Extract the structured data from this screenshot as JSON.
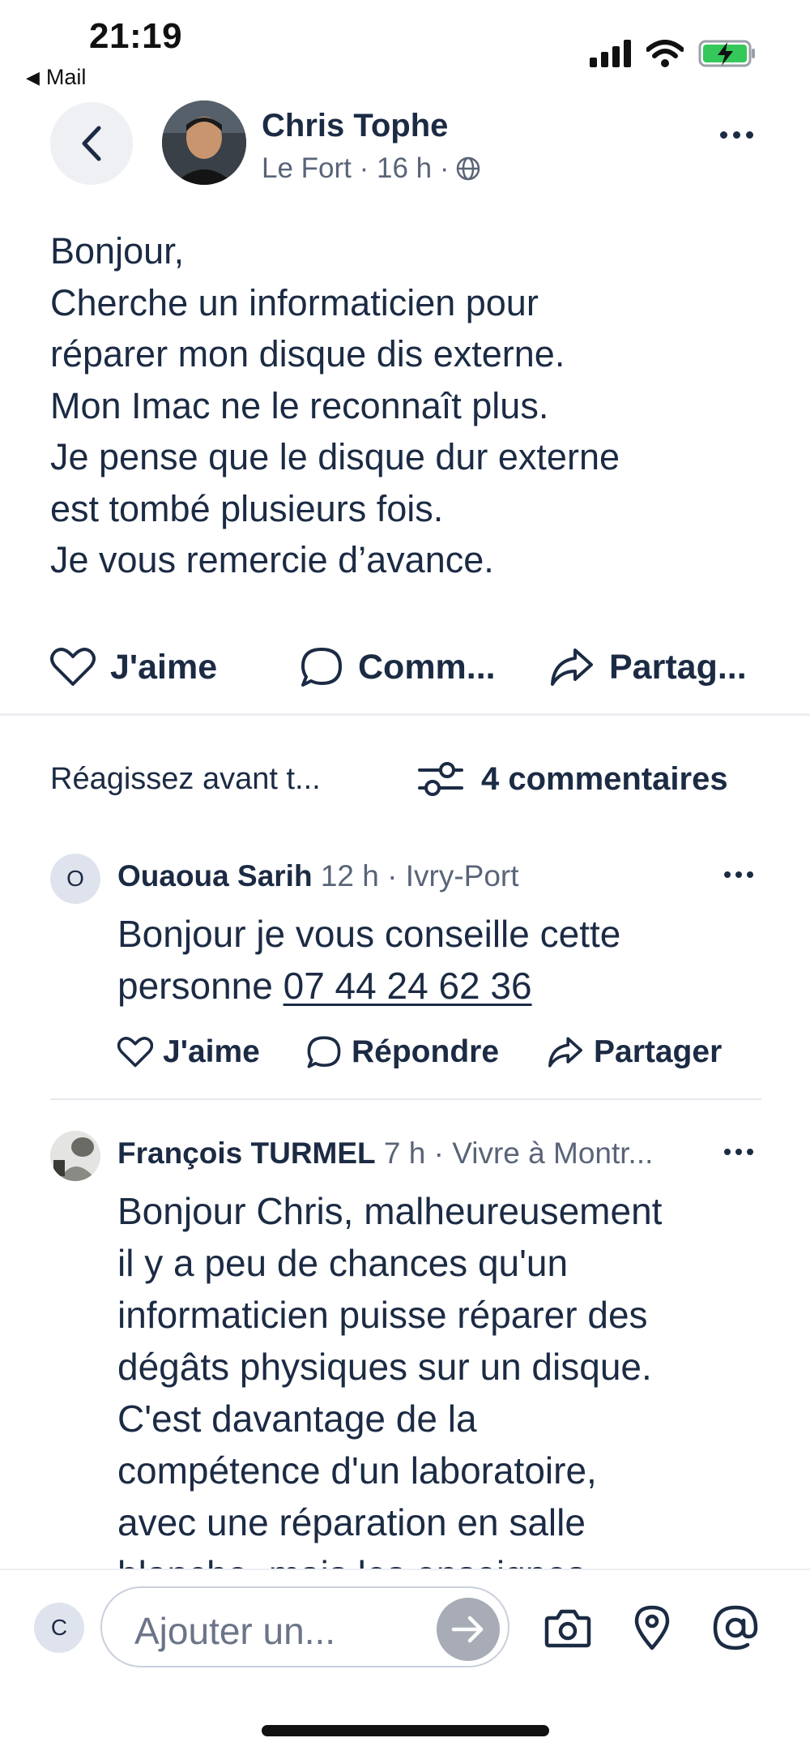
{
  "status_bar": {
    "time": "21:19",
    "back_app": "Mail"
  },
  "post": {
    "author": "Chris Tophe",
    "meta": "Le Fort · 16 h ·",
    "body_lines": [
      "Bonjour,",
      "Cherche un informaticien pour",
      "réparer mon disque dis externe.",
      "Mon Imac ne le reconnaît plus.",
      "Je pense que le disque dur externe",
      "est tombé plusieurs fois.",
      "Je vous remercie d’avance."
    ],
    "actions": {
      "like": "J'aime",
      "comment": "Comm...",
      "share": "Partag..."
    }
  },
  "reactions": {
    "prompt": "Réagissez avant t...",
    "comments_count": "4 commentaires"
  },
  "comments": [
    {
      "avatar_initial": "O",
      "name": "Ouaoua Sarih",
      "meta": " 12 h · Ivry-Port",
      "text_prefix": "Bonjour je vous conseille cette",
      "text_line2_prefix": "personne ",
      "phone": "07 44 24 62 36",
      "actions": {
        "like": "J'aime",
        "reply": "Répondre",
        "share": "Partager"
      }
    },
    {
      "name": "François TURMEL",
      "meta": " 7 h · Vivre à Montr...",
      "text_lines": [
        "Bonjour Chris, malheureusement",
        "il y a peu de chances qu'un",
        "informaticien puisse réparer des",
        "dégâts physiques sur un disque.",
        "C'est davantage de la",
        "compétence d'un laboratoire,",
        "avec une réparation en salle",
        "blanche, mais les enseignes"
      ]
    }
  ],
  "composer": {
    "avatar_initial": "C",
    "placeholder": "Ajouter un..."
  },
  "colors": {
    "text": "#1c2b44",
    "muted": "#5a6478",
    "battery": "#34c759",
    "send_button": "#a7acb6"
  }
}
